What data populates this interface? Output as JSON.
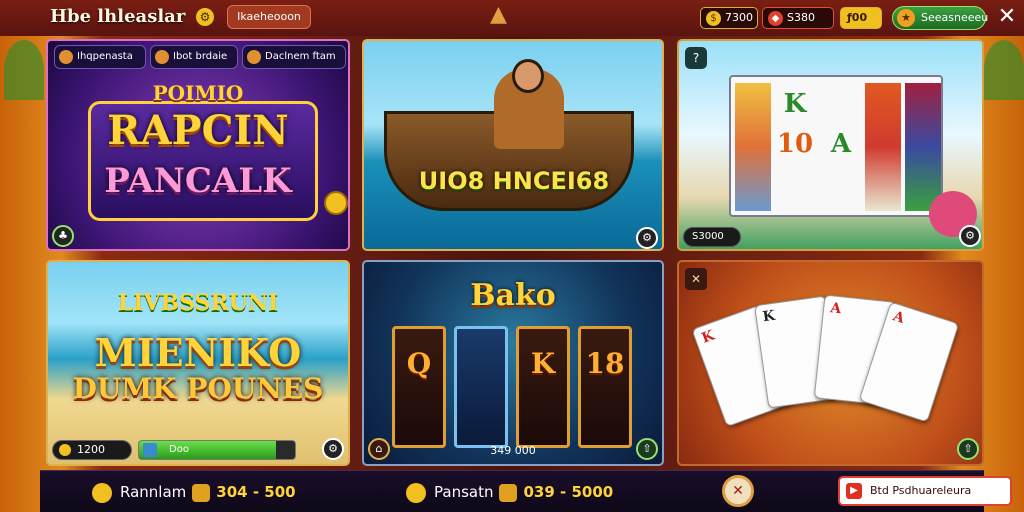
{
  "header": {
    "title": "Hbe lhleaslar",
    "title_badge_icon": "gear-icon",
    "tag": "Ikaeheooon",
    "stats": [
      {
        "value": "7300",
        "icon": "coin-icon"
      },
      {
        "value": "S380",
        "icon": "gem-icon"
      },
      {
        "value": "ƒ00"
      }
    ],
    "promo": "Seeasneeeu",
    "close_icon": "close-icon"
  },
  "cards": {
    "card1": {
      "chips": [
        "Ihqpenasta",
        "Ibot brdaie",
        "Daclnem ftam"
      ],
      "subtitle": "POIMIO",
      "title_line1": "RAPCIN",
      "title_line2": "PANCALK"
    },
    "card2": {
      "title": "UIO8 HNCEI68"
    },
    "card3": {
      "symbols": [
        "K",
        "10",
        "A"
      ],
      "value": "S3000"
    },
    "card4": {
      "subtitle": "LIVBSSRUNI",
      "title_line1": "MIENIKO",
      "title_line2": "DUMK POUNES",
      "balance": "1200",
      "bar_label": "Doo",
      "bar_progress": 0.88
    },
    "card5": {
      "title": "Bako",
      "reels": [
        "Q",
        "",
        "K",
        "18"
      ],
      "value": "349 000"
    },
    "card6": {
      "playing_cards": [
        "K",
        "K",
        "A",
        "A"
      ]
    }
  },
  "footer": {
    "jackpots": [
      {
        "label": "Rannlam",
        "value": "304 - 500"
      },
      {
        "label": "Pansatn",
        "value": "039 - 5000"
      }
    ],
    "cta": "Btd Psdhuareleura"
  }
}
